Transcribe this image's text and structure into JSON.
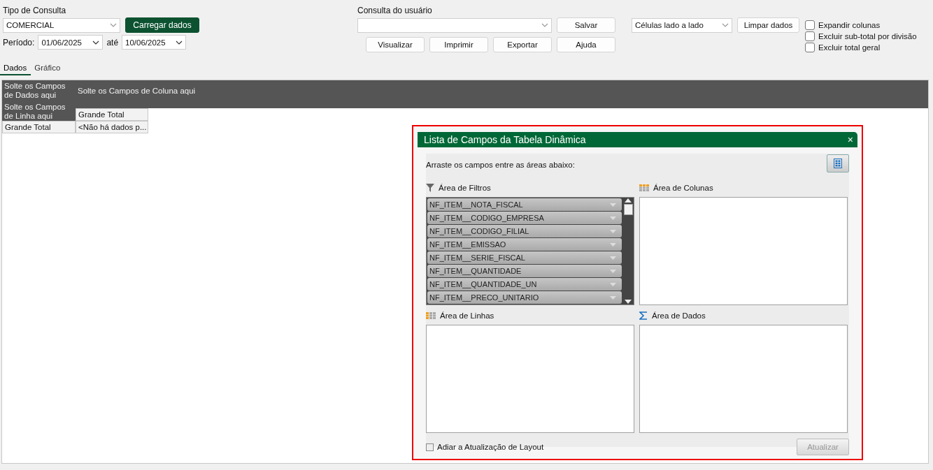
{
  "query_type": {
    "label": "Tipo de Consulta",
    "value": "COMERCIAL",
    "load_button": "Carregar dados"
  },
  "period": {
    "label": "Período:",
    "from": "01/06/2025",
    "separator": "até",
    "to": "10/06/2025"
  },
  "user_query": {
    "label": "Consulta do usuário",
    "save_button": "Salvar",
    "actions": [
      "Visualizar",
      "Imprimir",
      "Exportar",
      "Ajuda"
    ]
  },
  "layout_select": {
    "value": "Células lado a lado",
    "clear_button": "Limpar dados"
  },
  "options": [
    {
      "label": "Expandir colunas",
      "checked": false
    },
    {
      "label": "Excluir sub-total por divisão",
      "checked": false
    },
    {
      "label": "Excluir total geral",
      "checked": false
    }
  ],
  "tabs": [
    {
      "label": "Dados",
      "selected": true
    },
    {
      "label": "Gráfico",
      "selected": false
    }
  ],
  "pivot": {
    "data_drop": "Solte os Campos de Dados aqui",
    "column_drop": "Solte os Campos de Coluna aqui",
    "row_drop": "Solte os Campos de Linha aqui",
    "column_header": "Grande Total",
    "row_header": "Grande Total",
    "cell": "<Não há dados p..."
  },
  "field_list": {
    "title": "Lista de Campos da Tabela Dinâmica",
    "close": "×",
    "hint": "Arraste os campos entre as áreas abaixo:",
    "areas": [
      {
        "kind": "filters",
        "label": "Área de Filtros",
        "fields": [
          "NF_ITEM__NOTA_FISCAL",
          "NF_ITEM__CODIGO_EMPRESA",
          "NF_ITEM__CODIGO_FILIAL",
          "NF_ITEM__EMISSAO",
          "NF_ITEM__SERIE_FISCAL",
          "NF_ITEM__QUANTIDADE",
          "NF_ITEM__QUANTIDADE_UN",
          "NF_ITEM__PRECO_UNITARIO"
        ]
      },
      {
        "kind": "columns",
        "label": "Área de Colunas"
      },
      {
        "kind": "rows",
        "label": "Área de Linhas"
      },
      {
        "kind": "data",
        "label": "Área de Dados"
      }
    ],
    "defer": {
      "label": "Adiar a Atualização de Layout",
      "checked": false
    },
    "update_button": {
      "label": "Atualizar",
      "disabled": true
    }
  }
}
